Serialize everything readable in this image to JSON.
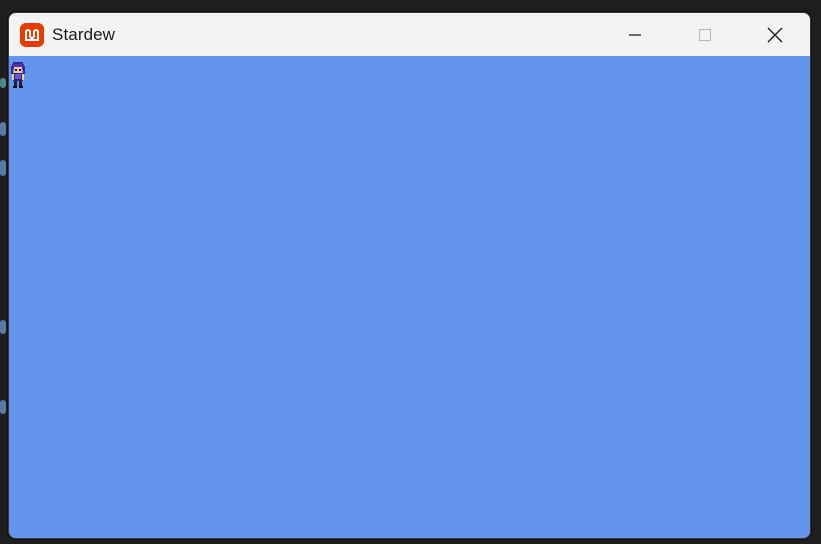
{
  "window": {
    "title": "Stardew"
  },
  "controls": {
    "minimize_icon": "minimize-icon",
    "maximize_icon": "maximize-icon",
    "close_icon": "close-icon"
  },
  "colors": {
    "game_background": "#6495ed",
    "titlebar": "#f3f3f3",
    "app_icon": "#e73c00",
    "desktop": "#1e1e1e"
  },
  "game": {
    "sprite": "player-character-sprite"
  }
}
